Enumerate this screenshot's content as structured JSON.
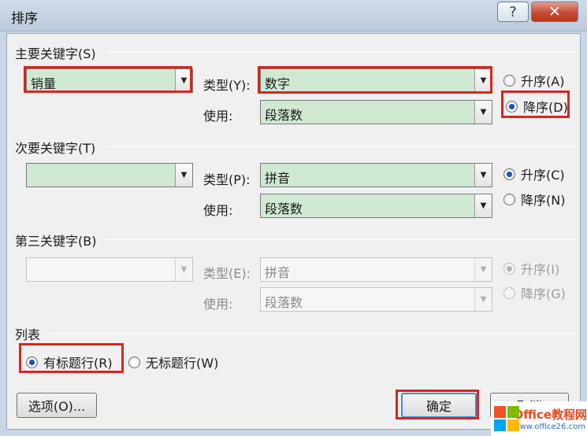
{
  "window": {
    "title": "排序",
    "help_glyph": "?",
    "close_glyph": "✕"
  },
  "primary_key": {
    "label": "主要关键字(S)",
    "column_value": "销量",
    "type_label": "类型(Y):",
    "type_value": "数字",
    "use_label": "使用:",
    "use_value": "段落数",
    "ascending_label": "升序(A)",
    "descending_label": "降序(D)",
    "order": "descending"
  },
  "secondary_key": {
    "label": "次要关键字(T)",
    "column_value": "",
    "type_label": "类型(P):",
    "type_value": "拼音",
    "use_label": "使用:",
    "use_value": "段落数",
    "ascending_label": "升序(C)",
    "descending_label": "降序(N)",
    "order": "ascending"
  },
  "third_key": {
    "label": "第三关键字(B)",
    "column_value": "",
    "type_label": "类型(E):",
    "type_value": "拼音",
    "use_label": "使用:",
    "use_value": "段落数",
    "ascending_label": "升序(I)",
    "descending_label": "降序(G)",
    "order": "ascending",
    "enabled": false
  },
  "list": {
    "label": "列表",
    "has_header_label": "有标题行(R)",
    "no_header_label": "无标题行(W)",
    "selected": "has_header"
  },
  "buttons": {
    "options": "选项(O)...",
    "ok": "确定",
    "cancel": "取消"
  },
  "watermark": {
    "line1": "Office教程网",
    "line2": "www.office26.com"
  },
  "colors": {
    "highlight": "#d7261f",
    "combo_fill": "#cfe9d3",
    "radio_checked": "#1f4ec7"
  }
}
